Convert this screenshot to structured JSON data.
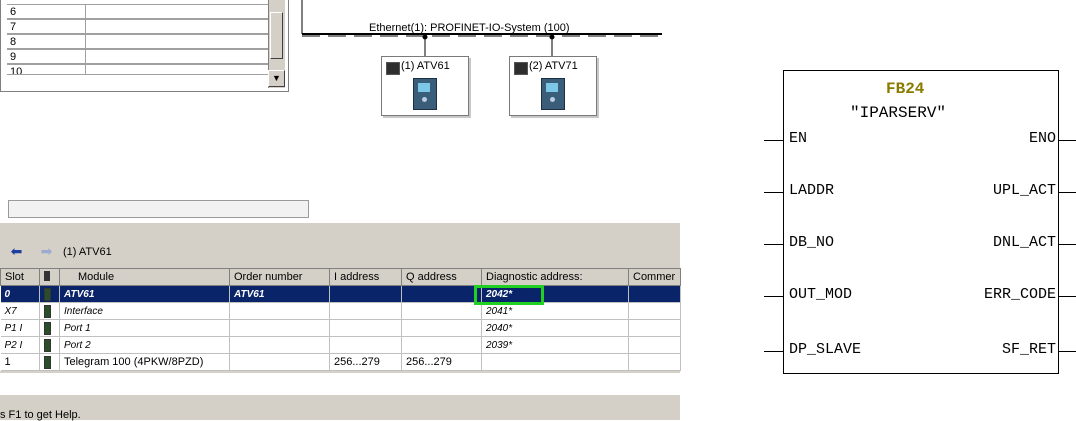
{
  "slot_list": {
    "rows": [
      "6",
      "7",
      "8",
      "9",
      "10"
    ]
  },
  "network": {
    "label": "Ethernet(1): PROFINET-IO-System (100)",
    "devices": [
      {
        "label": "(1) ATV61"
      },
      {
        "label": "(2) ATV71"
      }
    ]
  },
  "module_view": {
    "station": "(1)  ATV61",
    "columns": [
      "Slot",
      "",
      "Module",
      "Order number",
      "I address",
      "Q address",
      "Diagnostic address:",
      "Commer"
    ],
    "rows": [
      {
        "slot": "0",
        "module": "ATV61",
        "order": "ATV61",
        "i_addr": "",
        "q_addr": "",
        "diag": "2042*"
      },
      {
        "slot": "X7",
        "module": "Interface",
        "order": "",
        "i_addr": "",
        "q_addr": "",
        "diag": "2041*"
      },
      {
        "slot": "P1 I",
        "module": "Port 1",
        "order": "",
        "i_addr": "",
        "q_addr": "",
        "diag": "2040*"
      },
      {
        "slot": "P2 I",
        "module": "Port 2",
        "order": "",
        "i_addr": "",
        "q_addr": "",
        "diag": "2039*"
      },
      {
        "slot": "1",
        "module": "Telegram 100 (4PKW/8PZD)",
        "order": "",
        "i_addr": "256...279",
        "q_addr": "256...279",
        "diag": ""
      }
    ],
    "selected_row": 0,
    "highlight": "diagnostic-address-2042"
  },
  "status_bar": {
    "text": "s F1 to get Help."
  },
  "function_block": {
    "name": "FB24",
    "symbol": "\"IPARSERV\"",
    "inputs": [
      "EN",
      "LADDR",
      "DB_NO",
      "OUT_MOD",
      "DP_SLAVE"
    ],
    "outputs": [
      "ENO",
      "UPL_ACT",
      "DNL_ACT",
      "ERR_CODE",
      "SF_RET"
    ],
    "name_color": "#8a7a00"
  }
}
